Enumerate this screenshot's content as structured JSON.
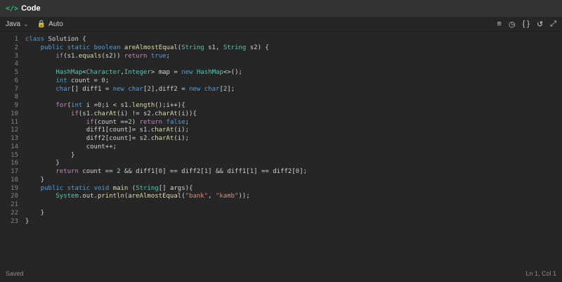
{
  "header": {
    "icon": "code-icon",
    "title": "Code"
  },
  "toolbar": {
    "language": "Java",
    "mode": "Auto"
  },
  "status": {
    "left": "Saved",
    "right": "Ln 1, Col 1"
  },
  "code": {
    "line_numbers": [
      "1",
      "2",
      "3",
      "4",
      "5",
      "6",
      "7",
      "8",
      "9",
      "10",
      "11",
      "12",
      "13",
      "14",
      "15",
      "16",
      "17",
      "18",
      "19",
      "20",
      "21",
      "22",
      "23"
    ],
    "lines": [
      "class Solution {",
      "    public static boolean areAlmostEqual(String s1, String s2) {",
      "        if(s1.equals(s2)) return true;",
      "",
      "        HashMap<Character,Integer> map = new HashMap<>();",
      "        int count = 0;",
      "        char[] diff1 = new char[2],diff2 = new char[2];",
      "",
      "        for(int i =0;i < s1.length();i++){",
      "            if(s1.charAt(i) != s2.charAt(i)){",
      "                if(count ==2) return false;",
      "                diff1[count]= s1.charAt(i);",
      "                diff2[count]= s2.charAt(i);",
      "                count++;",
      "            }",
      "        }",
      "        return count == 2 && diff1[0] == diff2[1] && diff1[1] == diff2[0];",
      "    }",
      "    public static void main (String[] args){",
      "        System.out.println(areAlmostEqual(\"bank\", \"kamb\"));",
      "",
      "    }",
      "}"
    ]
  }
}
